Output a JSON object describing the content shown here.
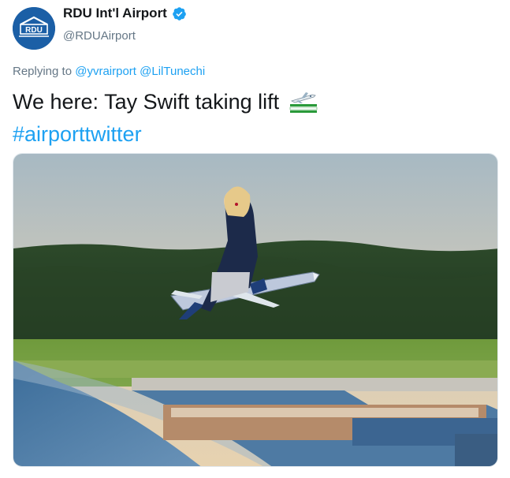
{
  "tweet": {
    "avatar_logo_text": "RDU",
    "display_name": "RDU Int'l Airport",
    "handle": "@RDUAirport",
    "verified": true,
    "reply_prefix": "Replying to",
    "reply_mentions": [
      "@yvrairport",
      "@LilTunechi"
    ],
    "text": "We here: Tay Swift taking lift",
    "emoji": "airplane-departure-flag-icon",
    "hashtag": "#airporttwitter",
    "media": {
      "description_icon": "photo-icon"
    }
  },
  "colors": {
    "accent": "#1da1f2",
    "muted": "#657786",
    "text": "#14171a",
    "avatar_bg": "#1b5fa6"
  }
}
